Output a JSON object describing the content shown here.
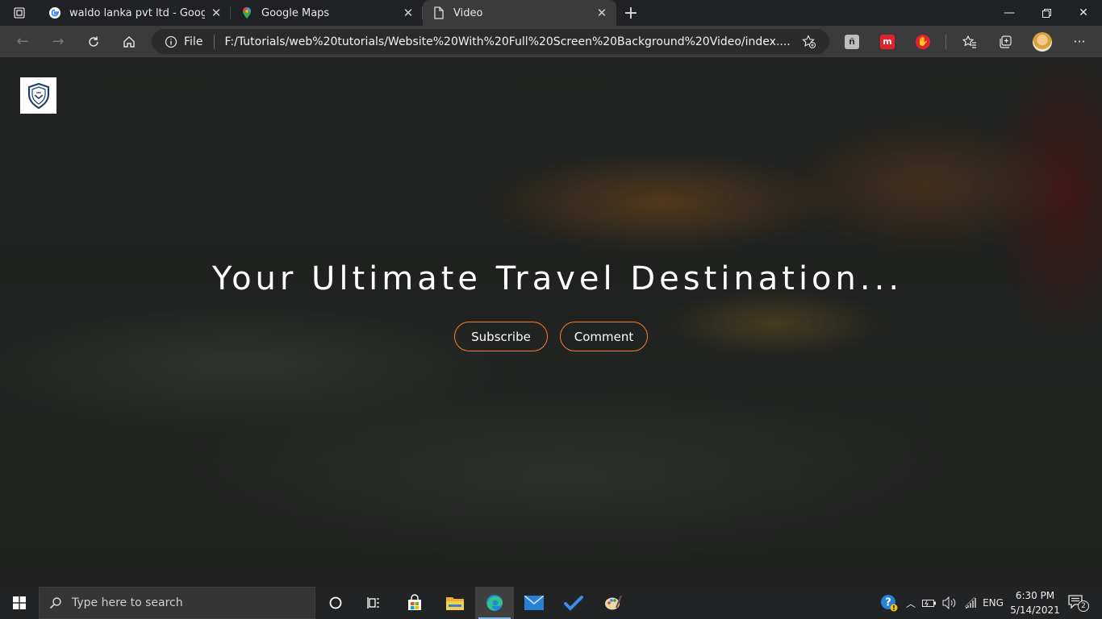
{
  "browser": {
    "tabs": [
      {
        "title": "waldo lanka pvt ltd - Google Sea",
        "icon": "google-icon",
        "active": false
      },
      {
        "title": "Google Maps",
        "icon": "maps-pin-icon",
        "active": false
      },
      {
        "title": "Video",
        "icon": "page-icon",
        "active": true
      }
    ],
    "address": {
      "scheme_label": "File",
      "url": "F:/Tutorials/web%20tutorials/Website%20With%20Full%20Screen%20Background%20Video/index...."
    }
  },
  "page": {
    "hero_title": "Your Ultimate Travel Destination...",
    "buttons": {
      "subscribe": "Subscribe",
      "comment": "Comment"
    },
    "accent_color": "#ff7a2f"
  },
  "taskbar": {
    "search_placeholder": "Type here to search",
    "language": "ENG",
    "time": "6:30 PM",
    "date": "5/14/2021",
    "notification_count": "2"
  }
}
